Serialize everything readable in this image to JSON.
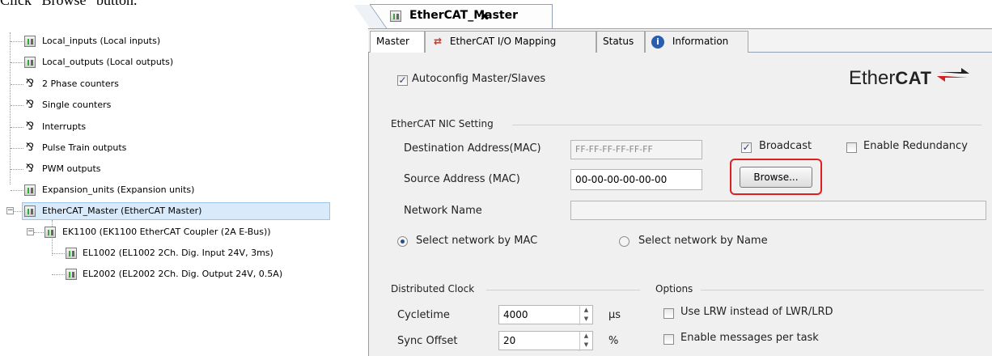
{
  "instruction": "Click “Browse” button.",
  "tree": {
    "items": [
      {
        "label": "Local_inputs (Local inputs)",
        "icon": "device-icon"
      },
      {
        "label": "Local_outputs (Local outputs)",
        "icon": "device-icon"
      },
      {
        "label": "2 Phase counters",
        "icon": "counter-icon"
      },
      {
        "label": "Single counters",
        "icon": "counter-icon"
      },
      {
        "label": "Interrupts",
        "icon": "counter-icon"
      },
      {
        "label": "Pulse Train outputs",
        "icon": "counter-icon"
      },
      {
        "label": "PWM outputs",
        "icon": "counter-icon"
      },
      {
        "label": "Expansion_units (Expansion units)",
        "icon": "device-icon"
      },
      {
        "label": "EtherCAT_Master (EtherCAT Master)",
        "icon": "device-icon",
        "selected": true
      },
      {
        "label": "EK1100 (EK1100 EtherCAT Coupler (2A E-Bus))",
        "icon": "device-icon"
      },
      {
        "label": "EL1002 (EL1002 2Ch. Dig. Input 24V, 3ms)",
        "icon": "device-icon"
      },
      {
        "label": "EL2002 (EL2002 2Ch. Dig. Output 24V, 0.5A)",
        "icon": "device-icon"
      }
    ]
  },
  "editor": {
    "doc_tab": {
      "title": "EtherCAT_Master",
      "close": "x"
    },
    "tabs": [
      {
        "label": "Master"
      },
      {
        "label": "EtherCAT I/O Mapping"
      },
      {
        "label": "Status"
      },
      {
        "label": "Information"
      }
    ],
    "autoconfig": {
      "label": "Autoconfig Master/Slaves",
      "checked": true
    },
    "logo": {
      "text_light": "Ether",
      "text_bold": "CAT"
    },
    "nic": {
      "section": "EtherCAT NIC Setting",
      "dest_label": "Destination Address(MAC)",
      "dest_value": "FF-FF-FF-FF-FF-FF",
      "broadcast_label": "Broadcast",
      "broadcast_checked": true,
      "redundancy_label": "Enable Redundancy",
      "redundancy_checked": false,
      "source_label": "Source Address (MAC)",
      "source_value": "00-00-00-00-00-00",
      "browse_label": "Browse...",
      "network_label": "Network Name",
      "network_value": "",
      "radio_mac": "Select network by MAC",
      "radio_name": "Select network by Name",
      "selected_radio": "mac"
    },
    "clock": {
      "section": "Distributed Clock",
      "cycletime_label": "Cycletime",
      "cycletime_value": "4000",
      "cycletime_unit": "µs",
      "sync_label": "Sync Offset",
      "sync_value": "20",
      "sync_unit": "%"
    },
    "options": {
      "section": "Options",
      "lrw_label": "Use LRW instead of LWR/LRD",
      "lrw_checked": false,
      "msg_label": "Enable messages per task",
      "msg_checked": false
    }
  },
  "colors": {
    "highlight": "#e02020",
    "selection": "#d9ebfb",
    "accent": "#2c4b8a"
  }
}
